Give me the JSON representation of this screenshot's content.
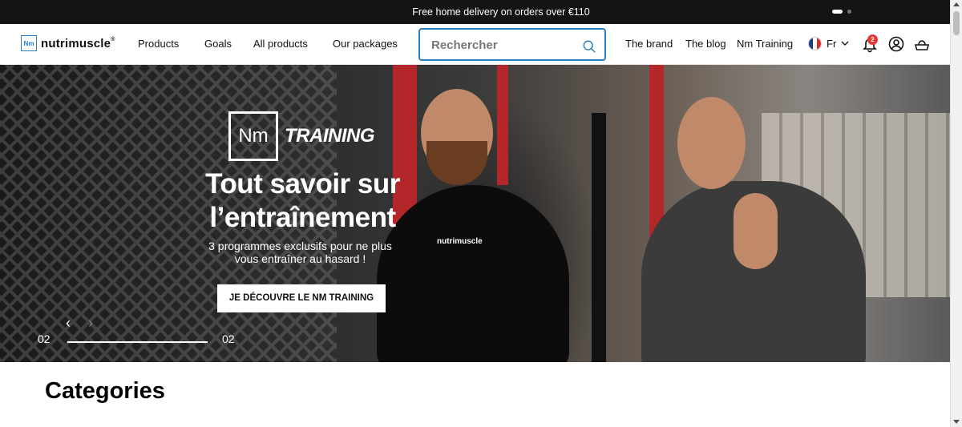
{
  "announcement": {
    "text": "Free home delivery on orders over €110",
    "dots": [
      true,
      false
    ]
  },
  "header": {
    "logo": {
      "mark": "Nm",
      "name": "nutrimuscle",
      "reg": "®"
    },
    "nav_left": [
      "Products",
      "Goals",
      "All products",
      "Our packages"
    ],
    "search": {
      "placeholder": "Rechercher"
    },
    "nav_right": [
      "The brand",
      "The blog",
      "Nm Training"
    ],
    "language": "Fr",
    "notifications_count": "2",
    "icons": [
      "search-icon",
      "chevron-down-icon",
      "bell-icon",
      "user-icon",
      "cart-icon"
    ]
  },
  "hero": {
    "badge_mark": "Nm",
    "badge_word": "TRAINING",
    "title_line1": "Tout savoir sur",
    "title_line2": "l’entraînement",
    "subtitle_line1": "3 programmes exclusifs pour ne plus",
    "subtitle_line2": "vous entraîner au hasard !",
    "cta": "JE DÉCOUVRE LE NM TRAINING",
    "shirt_logo": "nutrimuscle",
    "slide_current": "02",
    "slide_total": "02",
    "progress": 1.0
  },
  "section": {
    "categories_title": "Categories"
  },
  "colors": {
    "accent": "#2a7fc1",
    "badge": "#e53935",
    "dark": "#141414"
  }
}
